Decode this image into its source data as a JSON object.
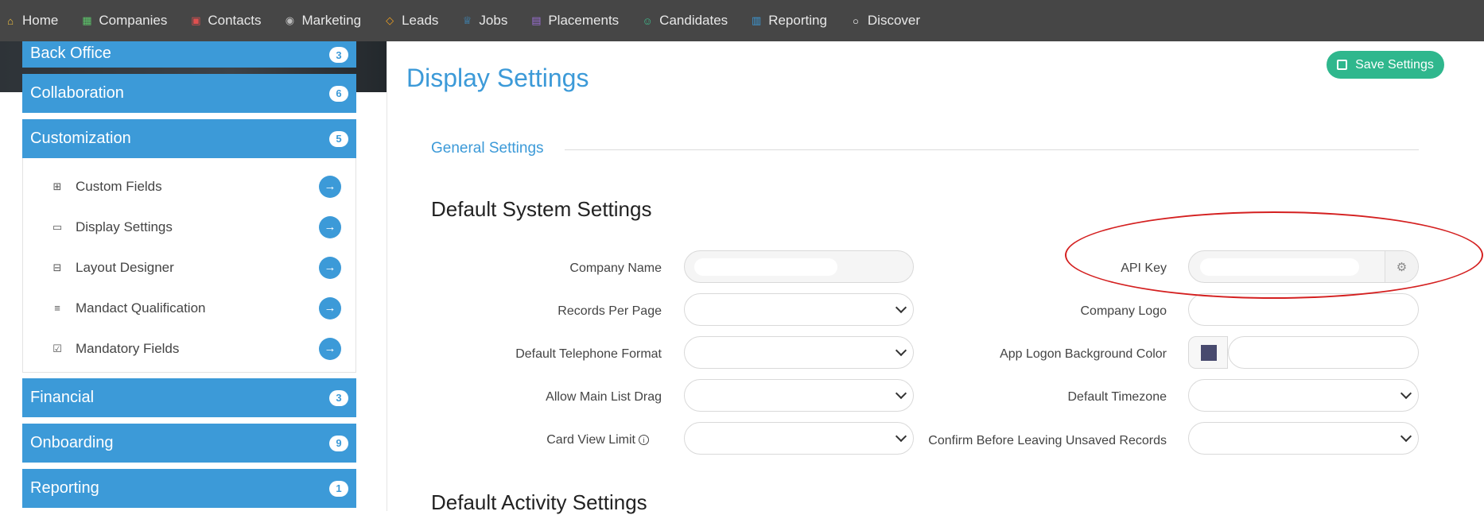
{
  "nav": {
    "items": [
      {
        "label": "Home",
        "icon": "home-icon",
        "color": "#f0c040"
      },
      {
        "label": "Companies",
        "icon": "building-icon",
        "color": "#5cc46a"
      },
      {
        "label": "Contacts",
        "icon": "contact-card-icon",
        "color": "#e05050"
      },
      {
        "label": "Marketing",
        "icon": "broadcast-icon",
        "color": "#bbbbbb"
      },
      {
        "label": "Leads",
        "icon": "diamond-icon",
        "color": "#f0a020"
      },
      {
        "label": "Jobs",
        "icon": "trophy-icon",
        "color": "#3c9ad8"
      },
      {
        "label": "Placements",
        "icon": "briefcase-icon",
        "color": "#9b6fd4"
      },
      {
        "label": "Candidates",
        "icon": "users-icon",
        "color": "#3fbf8f"
      },
      {
        "label": "Reporting",
        "icon": "bar-chart-icon",
        "color": "#3c9ad8"
      },
      {
        "label": "Discover",
        "icon": "search-icon",
        "color": "#ffffff"
      }
    ]
  },
  "sidebar": {
    "categories": [
      {
        "label": "Back Office",
        "count": "3"
      },
      {
        "label": "Collaboration",
        "count": "6"
      },
      {
        "label": "Customization",
        "count": "5"
      },
      {
        "label": "Financial",
        "count": "3"
      },
      {
        "label": "Onboarding",
        "count": "9"
      },
      {
        "label": "Reporting",
        "count": "1"
      }
    ],
    "sub_items": [
      {
        "label": "Custom Fields",
        "icon": "table-icon"
      },
      {
        "label": "Display Settings",
        "icon": "monitor-icon"
      },
      {
        "label": "Layout Designer",
        "icon": "layout-icon"
      },
      {
        "label": "Mandact Qualification",
        "icon": "list-icon"
      },
      {
        "label": "Mandatory Fields",
        "icon": "checkbox-icon"
      }
    ]
  },
  "main": {
    "title": "Display Settings",
    "save_label": "Save Settings",
    "section_tab": "General Settings",
    "heading_system": "Default System Settings",
    "heading_activity": "Default Activity Settings",
    "left_fields": [
      "Company Name",
      "Records Per Page",
      "Default Telephone Format",
      "Allow Main List Drag",
      "Card View Limit"
    ],
    "right_fields": [
      "API Key",
      "Company Logo",
      "App Logon Background Color",
      "Default Timezone",
      "Confirm Before Leaving Unsaved Records"
    ],
    "logon_bg_color": "#484a6e",
    "accent": "#3c9ad8",
    "save_color": "#2fb78d"
  }
}
